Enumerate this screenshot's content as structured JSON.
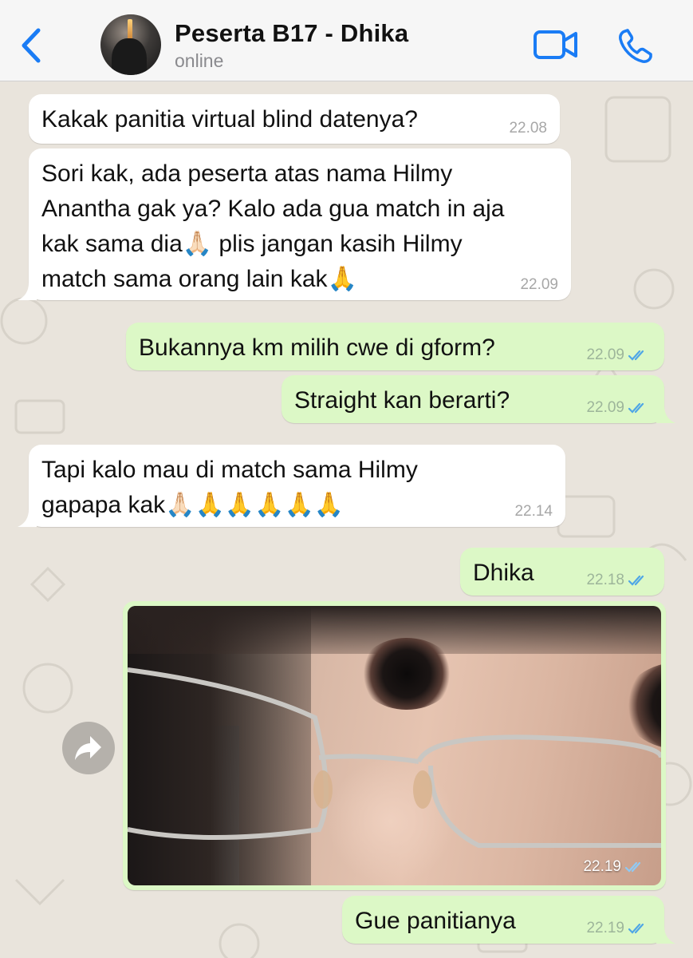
{
  "header": {
    "contact_name": "Peserta B17 - Dhika",
    "status": "online",
    "icons": {
      "back": "chevron-left-icon",
      "video": "video-camera-icon",
      "call": "phone-icon"
    }
  },
  "colors": {
    "accent": "#1a7cf5",
    "incoming_bubble": "#ffffff",
    "outgoing_bubble": "#dcf8c6",
    "wallpaper": "#e9e4dc",
    "read_check": "#4fa6e6"
  },
  "messages": [
    {
      "direction": "in",
      "text": "Kakak panitia virtual blind datenya?",
      "time": "22.08"
    },
    {
      "direction": "in",
      "line1": "Sori kak, ada peserta atas nama Hilmy",
      "line2": "Anantha gak ya? Kalo ada gua match in aja",
      "line3": "kak sama dia🙏🏻 plis jangan kasih Hilmy",
      "line4": "match sama orang lain kak🙏",
      "time": "22.09"
    },
    {
      "direction": "out",
      "text": "Bukannya km milih cwe di gform?",
      "time": "22.09",
      "status": "read"
    },
    {
      "direction": "out",
      "text": "Straight kan berarti?",
      "time": "22.09",
      "status": "read"
    },
    {
      "direction": "in",
      "line1": "Tapi kalo mau di match sama Hilmy",
      "line2": "gapapa kak🙏🏻🙏🙏🙏🙏🙏",
      "time": "22.14"
    },
    {
      "direction": "out",
      "text": "Dhika",
      "time": "22.18",
      "status": "read"
    },
    {
      "direction": "out",
      "type": "photo",
      "time": "22.19",
      "status": "read"
    },
    {
      "direction": "out",
      "text": "Gue panitianya",
      "time": "22.19",
      "status": "read"
    }
  ]
}
